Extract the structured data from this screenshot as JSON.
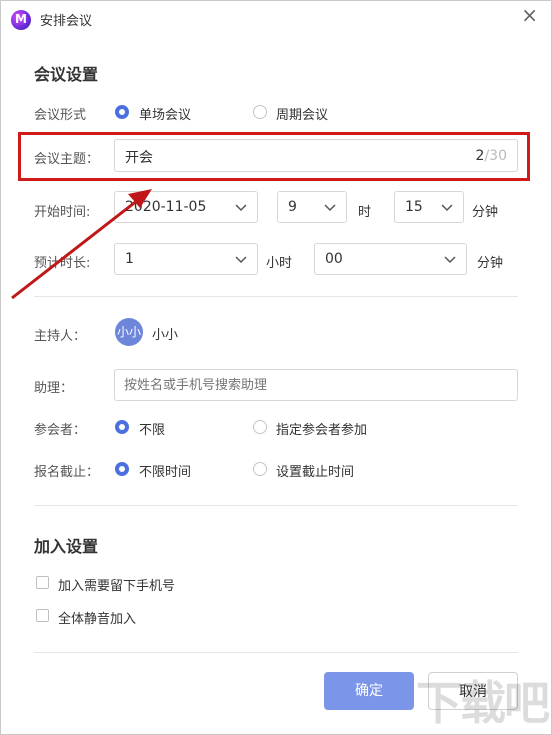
{
  "window": {
    "title": "安排会议",
    "close_glyph": "×"
  },
  "sections": {
    "meeting_settings": "会议设置",
    "join_settings": "加入设置"
  },
  "form": {
    "format": {
      "label": "会议形式",
      "options": [
        "单场会议",
        "周期会议"
      ],
      "selected": "单场会议"
    },
    "topic": {
      "label": "会议主题：",
      "value": "开会",
      "count": "2",
      "max": "/30"
    },
    "start": {
      "label": "开始时间:",
      "date": "2020-11-05",
      "hour": "9",
      "hour_unit": "时",
      "minute": "15",
      "minute_unit": "分钟"
    },
    "duration": {
      "label": "预计时长:",
      "hours": "1",
      "hours_unit": "小时",
      "minutes": "00",
      "minutes_unit": "分钟"
    },
    "host": {
      "label": "主持人：",
      "avatar_text": "小小",
      "name": "小小"
    },
    "assistant": {
      "label": "助理：",
      "placeholder": "按姓名或手机号搜索助理",
      "value": ""
    },
    "participants": {
      "label": "参会者：",
      "options": [
        "不限",
        "指定参会者参加"
      ],
      "selected": "不限"
    },
    "deadline": {
      "label": "报名截止：",
      "options": [
        "不限时间",
        "设置截止时间"
      ],
      "selected": "不限时间"
    }
  },
  "join": {
    "require_phone": {
      "label": "加入需要留下手机号",
      "checked": false
    },
    "mute_all": {
      "label": "全体静音加入",
      "checked": false
    }
  },
  "buttons": {
    "confirm": "确定",
    "cancel": "取消"
  },
  "colors": {
    "accent": "#4b6fde",
    "primary_button": "#7b96e8",
    "annotation": "#d11b1b"
  },
  "watermark": "下载吧"
}
